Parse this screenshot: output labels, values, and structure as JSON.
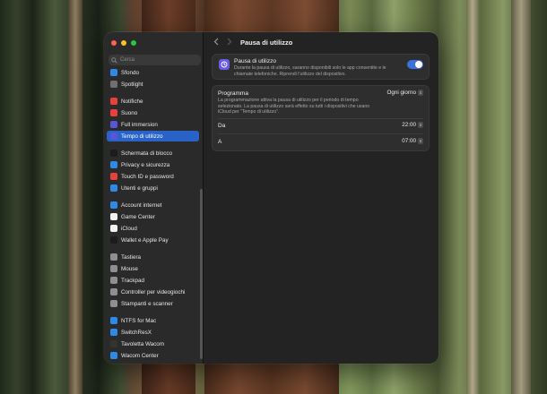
{
  "window": {
    "title": "Pausa di utilizzo",
    "search_placeholder": "Cerca"
  },
  "sidebar": {
    "items": [
      {
        "label": "Sfondo",
        "icon": "wallpaper-icon",
        "color": "#2e8ae6"
      },
      {
        "label": "Spotlight",
        "icon": "spotlight-icon",
        "color": "#6f6f73"
      },
      {
        "label": "Notifiche",
        "icon": "notifications-icon",
        "color": "#e8413c"
      },
      {
        "label": "Suono",
        "icon": "sound-icon",
        "color": "#e8413c"
      },
      {
        "label": "Full immersion",
        "icon": "focus-icon",
        "color": "#5856d6"
      },
      {
        "label": "Tempo di utilizzo",
        "icon": "screen-time-icon",
        "color": "#5856d6",
        "active": true
      },
      {
        "label": "Schermata di blocco",
        "icon": "lock-screen-icon",
        "color": "#1c1c1e"
      },
      {
        "label": "Privacy e sicurezza",
        "icon": "privacy-icon",
        "color": "#2e8ae6"
      },
      {
        "label": "Touch ID e password",
        "icon": "touch-id-icon",
        "color": "#e8413c"
      },
      {
        "label": "Utenti e gruppi",
        "icon": "users-icon",
        "color": "#2e8ae6"
      },
      {
        "label": "Account internet",
        "icon": "internet-accounts-icon",
        "color": "#2e8ae6"
      },
      {
        "label": "Game Center",
        "icon": "game-center-icon",
        "color": "#f2f2f2"
      },
      {
        "label": "iCloud",
        "icon": "icloud-icon",
        "color": "#f2f2f2"
      },
      {
        "label": "Wallet e Apple Pay",
        "icon": "wallet-icon",
        "color": "#1c1c1e"
      },
      {
        "label": "Tastiera",
        "icon": "keyboard-icon",
        "color": "#8e8e93"
      },
      {
        "label": "Mouse",
        "icon": "mouse-icon",
        "color": "#8e8e93"
      },
      {
        "label": "Trackpad",
        "icon": "trackpad-icon",
        "color": "#8e8e93"
      },
      {
        "label": "Controller per videogiochi",
        "icon": "game-controller-icon",
        "color": "#8e8e93"
      },
      {
        "label": "Stampanti e scanner",
        "icon": "printer-icon",
        "color": "#8e8e93"
      },
      {
        "label": "NTFS for Mac",
        "icon": "ntfs-icon",
        "color": "#2e8ae6"
      },
      {
        "label": "SwitchResX",
        "icon": "switchresx-icon",
        "color": "#2e8ae6"
      },
      {
        "label": "Tavoletta Wacom",
        "icon": "wacom-tablet-icon",
        "color": "#333333"
      },
      {
        "label": "Wacom Center",
        "icon": "wacom-center-icon",
        "color": "#2e8ae6"
      }
    ]
  },
  "downtime": {
    "title": "Pausa di utilizzo",
    "description": "Durante la pausa di utilizzo, saranno disponibili solo le app consentite e le chiamate telefoniche. Riprendi l’utilizzo del dispositivo.",
    "enabled": true
  },
  "schedule": {
    "label": "Programma",
    "value": "Ogni giorno",
    "description": "La programmazione attiva la pausa di utilizzo per il periodo di tempo selezionato. La pausa di utilizzo avrà effetto su tutti i dispositivi che usano iCloud per “Tempo di utilizzo”.",
    "from_label": "Da",
    "from_value": "22:00",
    "to_label": "A",
    "to_value": "07:00"
  },
  "help_label": "?"
}
